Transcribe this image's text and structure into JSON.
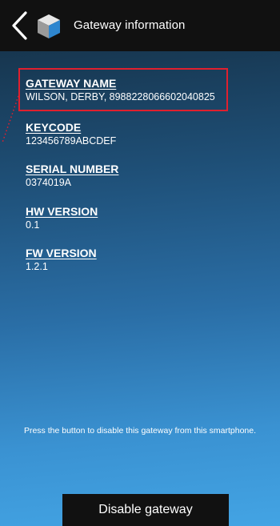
{
  "header": {
    "title": "Gateway information",
    "back_icon": "chevron-left-icon",
    "device_icon": "cube-icon"
  },
  "fields": [
    {
      "label": "GATEWAY NAME",
      "value": "WILSON, DERBY, 8988228066602040825"
    },
    {
      "label": "KEYCODE",
      "value": "123456789ABCDEF"
    },
    {
      "label": "SERIAL NUMBER",
      "value": "0374019A"
    },
    {
      "label": "HW VERSION",
      "value": "0.1"
    },
    {
      "label": "FW VERSION",
      "value": "1.2.1"
    }
  ],
  "info_text": "Press the button to disable this gateway from this smartphone.",
  "disable_button_label": "Disable gateway",
  "colors": {
    "header_bg": "#111111",
    "highlight": "#e0202e",
    "gradient_top": "#17364f",
    "gradient_bottom": "#43a4e4"
  }
}
